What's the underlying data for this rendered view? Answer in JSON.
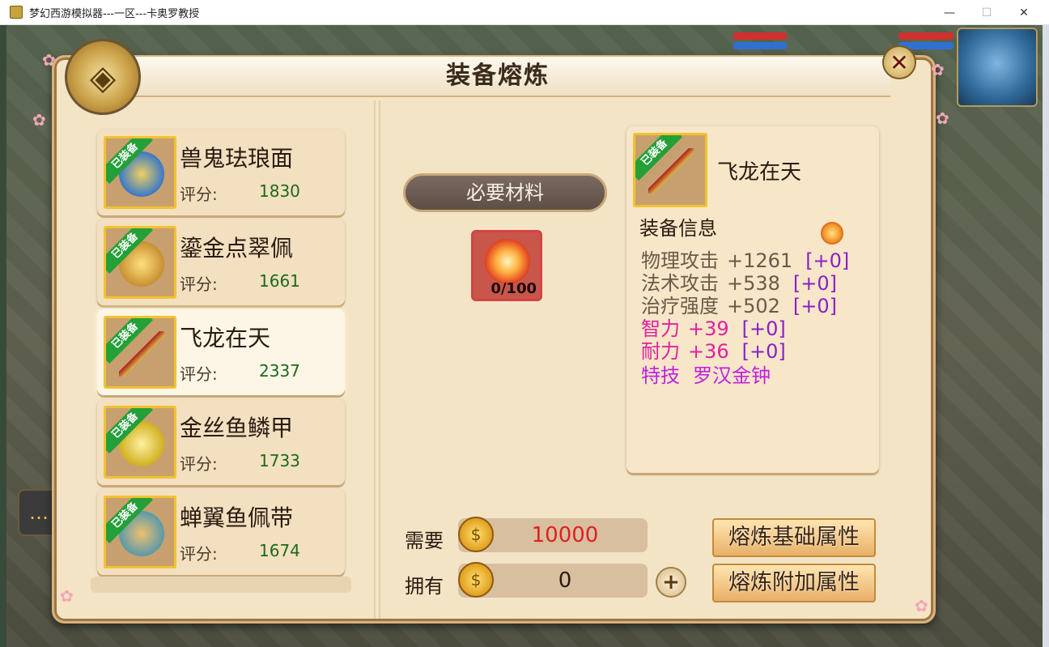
{
  "window": {
    "title": "梦幻西游模拟器---一区---卡奥罗教授",
    "minimize": "—",
    "maximize": "☐",
    "close": "✕"
  },
  "panel": {
    "title": "装备熔炼",
    "close_icon": "✕"
  },
  "items": [
    {
      "tag": "已装备",
      "name": "兽鬼珐琅面",
      "score_label": "评分:",
      "score": "1830",
      "art_color": "#3a78c8"
    },
    {
      "tag": "已装备",
      "name": "鎏金点翠佩",
      "score_label": "评分:",
      "score": "1661",
      "art_color": "#c89030"
    },
    {
      "tag": "已装备",
      "name": "飞龙在天",
      "score_label": "评分:",
      "score": "2337",
      "art_color": "#b02020"
    },
    {
      "tag": "已装备",
      "name": "金丝鱼鳞甲",
      "score_label": "评分:",
      "score": "1733",
      "art_color": "#d0b020"
    },
    {
      "tag": "已装备",
      "name": "蝉翼鱼佩带",
      "score_label": "评分:",
      "score": "1674",
      "art_color": "#c05a30"
    }
  ],
  "selected_index": 2,
  "materials": {
    "banner": "必要材料",
    "count": "0/100"
  },
  "detail": {
    "tag": "已装备",
    "name": "飞龙在天",
    "section": "装备信息",
    "stats": [
      {
        "name": "物理攻击",
        "value": "+1261",
        "bonus": "[+0]",
        "color": "#6a5a48"
      },
      {
        "name": "法术攻击",
        "value": "+538",
        "bonus": "[+0]",
        "color": "#6a5a48"
      },
      {
        "name": "治疗强度",
        "value": "+502",
        "bonus": "[+0]",
        "color": "#6a5a48"
      },
      {
        "name": "智力",
        "value": "+39",
        "bonus": "[+0]",
        "color": "#e020a0"
      },
      {
        "name": "耐力",
        "value": "+36",
        "bonus": "[+0]",
        "color": "#e020a0"
      },
      {
        "name": "特技",
        "value": "罗汉金钟",
        "bonus": "",
        "color": "#c020e0"
      }
    ],
    "bonus_color": "#8a20c8"
  },
  "cost": {
    "need_label": "需要",
    "need_value": "10000",
    "have_label": "拥有",
    "have_value": "0",
    "coin_glyph": "$"
  },
  "actions": {
    "base": "熔炼基础属性",
    "extra": "熔炼附加属性",
    "plus": "+"
  },
  "hud": {
    "chat_icon": "…"
  }
}
